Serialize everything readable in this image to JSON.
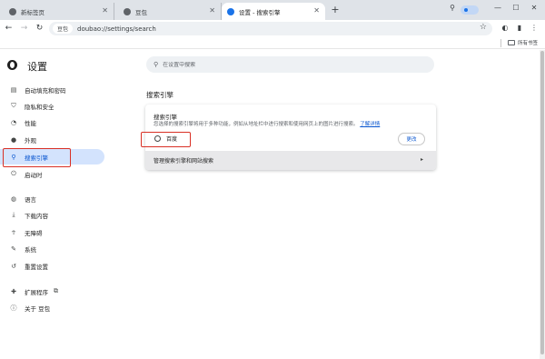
{
  "browser": {
    "tabs": [
      {
        "label": "新标签页",
        "active": false
      },
      {
        "label": "豆包",
        "active": false
      },
      {
        "label": "设置 - 搜索引擎",
        "active": true
      }
    ],
    "chip": "豆包",
    "url": "doubao://settings/search",
    "all_bookmarks": "所有书签"
  },
  "settings": {
    "title": "设置",
    "search_placeholder": "在设置中搜索"
  },
  "sidebar": {
    "items": [
      {
        "label": "自动填充和密码",
        "icon": "key-icon"
      },
      {
        "label": "隐私和安全",
        "icon": "shield-icon"
      },
      {
        "label": "性能",
        "icon": "speedometer-icon"
      },
      {
        "label": "外观",
        "icon": "palette-icon"
      },
      {
        "label": "搜索引擎",
        "icon": "search-icon",
        "selected": true
      },
      {
        "label": "启动时",
        "icon": "power-icon"
      },
      {
        "label": "语言",
        "icon": "globe-icon"
      },
      {
        "label": "下载内容",
        "icon": "download-icon"
      },
      {
        "label": "无障碍",
        "icon": "accessibility-icon"
      },
      {
        "label": "系统",
        "icon": "wrench-icon"
      },
      {
        "label": "重置设置",
        "icon": "history-icon"
      },
      {
        "label": "扩展程序",
        "icon": "puzzle-icon"
      },
      {
        "label": "关于 豆包",
        "icon": "info-icon"
      }
    ]
  },
  "main": {
    "section_heading": "搜索引擎",
    "card_title": "搜索引擎",
    "card_desc": "您选择的搜索引擎将用于多种功能，例如从地址栏中进行搜索和使用网页上的图片进行搜索。",
    "learn_more": "了解详情",
    "engine_name": "百度",
    "change_label": "更改",
    "manage_label": "管理搜索引擎和网站搜索"
  },
  "colors": {
    "accent": "#0b57d0",
    "selected_bg": "#d3e3fd",
    "highlight": "#d93025"
  }
}
